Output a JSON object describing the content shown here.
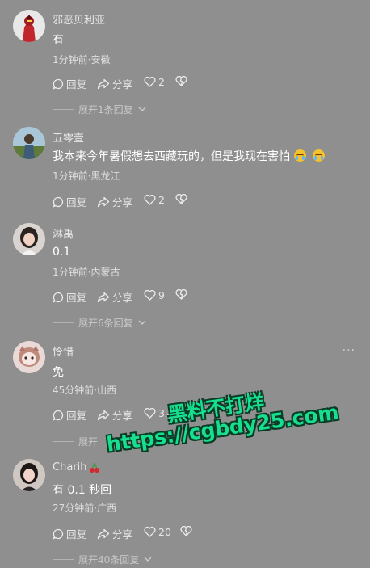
{
  "comments": [
    {
      "username": "邪恶贝利亚",
      "text": "有",
      "meta": "1分钟前·安徽",
      "reply_label": "回复",
      "share_label": "分享",
      "likes": "2",
      "expand_label": "展开1条回复"
    },
    {
      "username": "五零壹",
      "text": "我本来今年暑假想去西藏玩的，但是我现在害怕",
      "meta": "1分钟前·黑龙江",
      "reply_label": "回复",
      "share_label": "分享",
      "likes": "2"
    },
    {
      "username": "淋禹",
      "text": "0.1",
      "meta": "1分钟前·内蒙古",
      "reply_label": "回复",
      "share_label": "分享",
      "likes": "9",
      "expand_label": "展开6条回复"
    },
    {
      "username": "怜惜",
      "text": "免",
      "meta": "45分钟前·山西",
      "reply_label": "回复",
      "share_label": "分享",
      "likes": "37",
      "expand_label": "展开"
    },
    {
      "username": "Charih",
      "text": "有 0.1 秒回",
      "meta": "27分钟前·广西",
      "reply_label": "回复",
      "share_label": "分享",
      "likes": "20",
      "expand_label": "展开40条回复"
    }
  ],
  "more_label": "···",
  "watermark": {
    "line1": "黑料不打烊",
    "line2": "https://cgbdy25.com"
  },
  "colors": {
    "background": "#8f8f8f",
    "watermark_fill": "#16e08f",
    "watermark_outline": "#0a3b26"
  },
  "icons": [
    "reply-icon",
    "share-icon",
    "like-icon",
    "dislike-icon",
    "chevron-down-icon",
    "cherry-icon",
    "crying-emoji-icon",
    "more-icon"
  ]
}
